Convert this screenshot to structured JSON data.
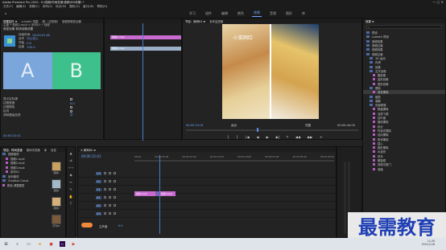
{
  "app": {
    "title": "Adobe Premiere Pro 2020 - D:\\视频\\时间变速\\视频\\MG效果\\ *"
  },
  "menus": [
    "文件(F)",
    "编辑(E)",
    "剪辑(C)",
    "序列(S)",
    "标记(M)",
    "图形(G)",
    "窗口(W)",
    "帮助(H)"
  ],
  "workspaces": [
    "学习",
    "组件",
    "编辑",
    "颜色",
    "效果",
    "音频",
    "图形",
    "库"
  ],
  "active_workspace": "效果",
  "effect_controls": {
    "tabs": [
      "效果控件 ≡",
      "Lumetri 范围",
      "源：(无剪辑)",
      "音频剪辑混合器"
    ],
    "source_line": "主要 * 视频2.mp4 ∨ 序列01 * 视频",
    "section": "渐变划像 转场划像设置",
    "fields": [
      {
        "label": "持续时间",
        "value": "00:00:01:00"
      },
      {
        "label": "对齐",
        "value": "中心切入"
      },
      {
        "label": "开始",
        "value": "0.0"
      },
      {
        "label": "结束",
        "value": "100.0"
      }
    ],
    "preview_a": "A",
    "preview_b": "B",
    "props": [
      {
        "label": "显示实际源"
      },
      {
        "label": "边框宽度",
        "value": "0.0"
      },
      {
        "label": "边框颜色"
      },
      {
        "label": "反向"
      },
      {
        "label": "消除锯齿品质",
        "value": "中"
      }
    ],
    "timecode": "00:00:15:01",
    "mini_clips": [
      "视频1.mp4",
      "视频2.mp4"
    ]
  },
  "program": {
    "tabs": [
      "节目：序列01 ≡",
      "参考监视器"
    ],
    "overlay_text": "·小菜网红·",
    "tc_left": "00:00:15:01",
    "tc_right": "00:00:44:00",
    "fit": "适合",
    "quality": "完整"
  },
  "transport": [
    "{",
    "}",
    "|◀",
    "◀",
    "▶",
    "▶|",
    "⤒",
    "◀◀",
    "▶▶",
    "+"
  ],
  "project": {
    "tabs": [
      "项目：时间变速",
      "媒体浏览器",
      "库",
      "信息"
    ],
    "items": [
      "视频素材",
      "视频1.mp4",
      "视频2.mp4",
      "视频3.mp4",
      "序列01",
      "序列素材",
      "Creative Cloud",
      "颜色 调整图层"
    ],
    "thumb_labels": [
      "视频1",
      "视频2",
      "视频3",
      "序列01"
    ]
  },
  "timeline": {
    "tabs": [
      "× 序列01 ≡"
    ],
    "timecode": "00:00:15:01",
    "ruler": [
      "00:00",
      "00:00:05:00",
      "00:00:10:00",
      "00:00:15:00",
      "00:00:20:00",
      "00:00:25:00",
      "00:00:30:00",
      "00:00:35:00"
    ],
    "tracks": [
      {
        "name": "V3"
      },
      {
        "name": "V2"
      },
      {
        "name": "V1"
      },
      {
        "name": "A1"
      },
      {
        "name": "A2"
      },
      {
        "name": "A3"
      }
    ],
    "clips": [
      "视频1.mp4",
      "视频2.mp4"
    ],
    "master": "主声道",
    "master_value": "0.0"
  },
  "effects": {
    "title": "效果 ≡",
    "items": [
      "预设",
      "Lumetri 预设",
      "音频效果",
      "音频过渡",
      "视频效果",
      "视频过渡",
      "3D 运动",
      "内滑",
      "划像",
      "交叉划像",
      "圆划像",
      "盒形划像",
      "菱形划像",
      "擦除",
      "渐变擦除",
      "缩放",
      "溶解",
      "页面剥落",
      "棋盘擦除",
      "油漆飞溅",
      "百叶窗",
      "随机擦除",
      "拆分",
      "时钟式擦除",
      "径向擦除",
      "带状擦除",
      "插入",
      "楔形擦除",
      "水波块",
      "风车",
      "螺旋框",
      "双侧平推门",
      "渐隐"
    ]
  },
  "watermark": "最需教育",
  "taskbar": {
    "time": "11:39",
    "date": "2021/1/18"
  }
}
